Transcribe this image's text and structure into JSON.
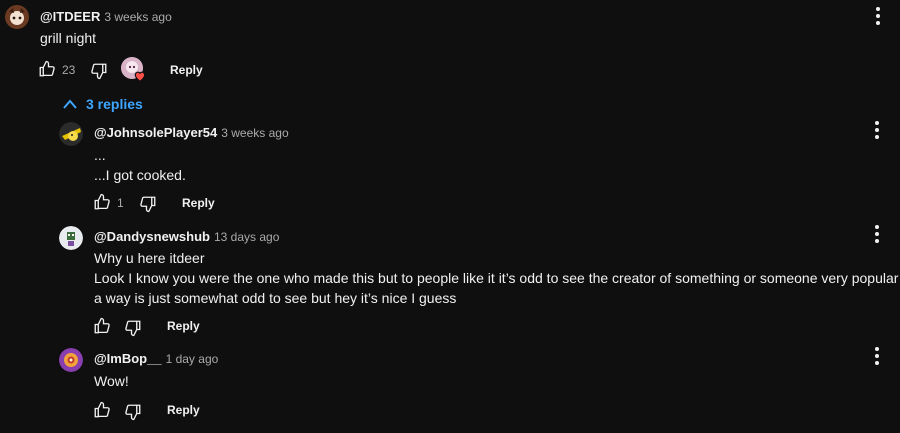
{
  "comment": {
    "handle": "@ITDEER",
    "time": "3 weeks ago",
    "text": "grill night",
    "likes": "23",
    "reply_label": "Reply"
  },
  "replies_toggle": {
    "label": "3 replies"
  },
  "replies": [
    {
      "handle": "@JohnsolePlayer54",
      "time": "3 weeks ago",
      "lines": [
        "...",
        "...I got cooked."
      ],
      "likes": "1",
      "reply_label": "Reply"
    },
    {
      "handle": "@Dandysnewshub",
      "time": "13 days ago",
      "lines": [
        "Why u here itdeer",
        "Look I know you were the one who made this but to people like it it’s odd to see the creator of something or someone very popular in",
        "a way is just somewhat odd to see but hey it’s nice I guess"
      ],
      "reply_label": "Reply"
    },
    {
      "handle": "@ImBop__",
      "time": "1 day ago",
      "lines": [
        "Wow!"
      ],
      "reply_label": "Reply"
    }
  ],
  "colors": {
    "background": "#0f0f0f",
    "text": "#f1f1f1",
    "muted": "#aaaaaa",
    "link": "#3ea6ff",
    "heart": "#ff4e45"
  },
  "icons": [
    "thumb-up-icon",
    "thumb-down-icon",
    "kebab-menu-icon",
    "chevron-up-icon",
    "heart-icon"
  ]
}
